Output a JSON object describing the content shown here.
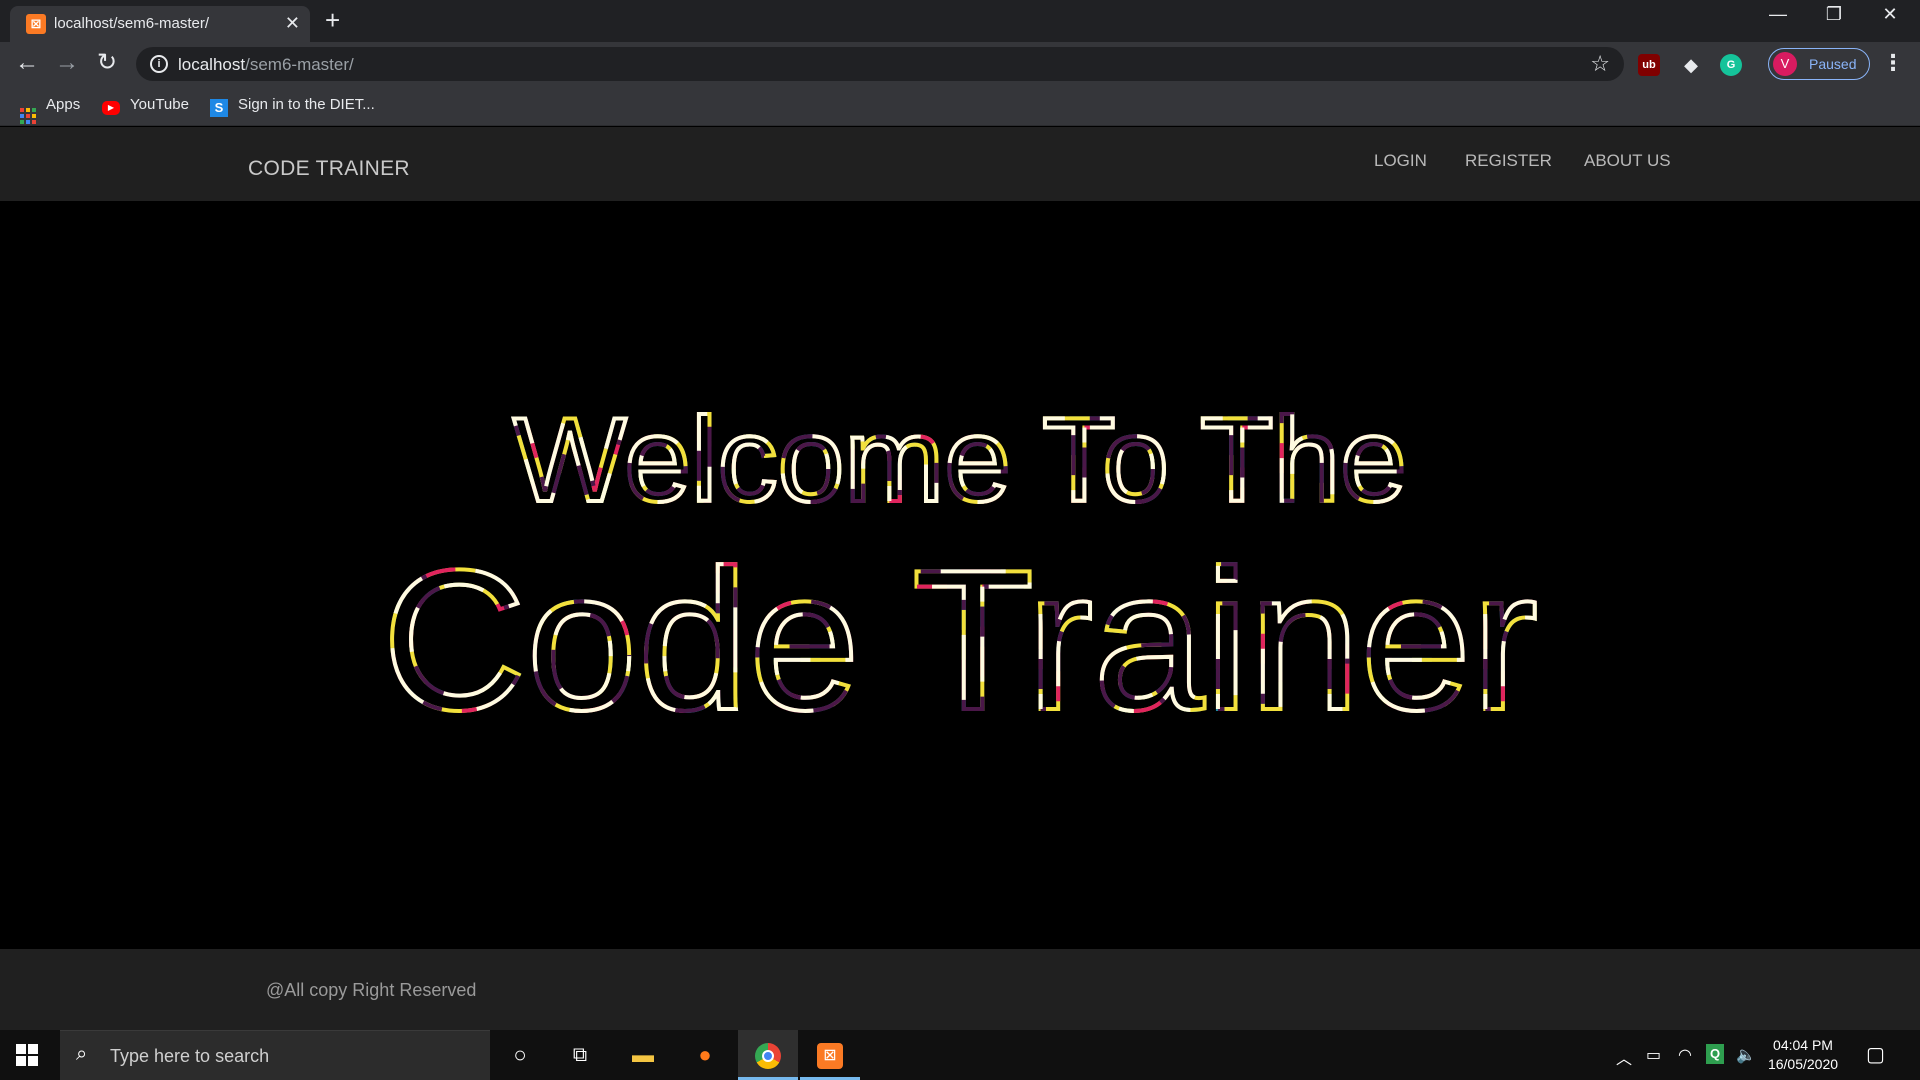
{
  "browser": {
    "tab_title": "localhost/sem6-master/",
    "url_host": "localhost",
    "url_path": "/sem6-master/",
    "profile_initial": "V",
    "profile_status": "Paused",
    "bookmarks": [
      {
        "label": "Apps",
        "icon": "apps-grid-icon"
      },
      {
        "label": "YouTube",
        "icon": "youtube-icon"
      },
      {
        "label": "Sign in to the DIET...",
        "icon": "s-logo-icon"
      }
    ],
    "extensions": [
      {
        "icon": "ublock-icon",
        "text": "ub",
        "color": "#800000"
      },
      {
        "icon": "shield-extension-icon",
        "text": "◆",
        "color": "#35363a"
      },
      {
        "icon": "grammarly-icon",
        "text": "G",
        "color": "#15c39a"
      }
    ]
  },
  "site": {
    "brand": "CODE TRAINER",
    "nav": [
      "LOGIN",
      "REGISTER",
      "ABOUT US"
    ],
    "hero_line1": "Welcome To The",
    "hero_line2": "Code Trainer",
    "footer": "@All copy Right Reserved"
  },
  "taskbar": {
    "search_placeholder": "Type here to search",
    "time": "04:04 PM",
    "date": "16/05/2020"
  },
  "colors": {
    "stroke_cyan": "#1f8ea3",
    "stroke_yellow": "#f2e03c",
    "stroke_pink": "#e0245e",
    "stroke_purple": "#4a1748",
    "stroke_cream": "#fffbe0"
  }
}
